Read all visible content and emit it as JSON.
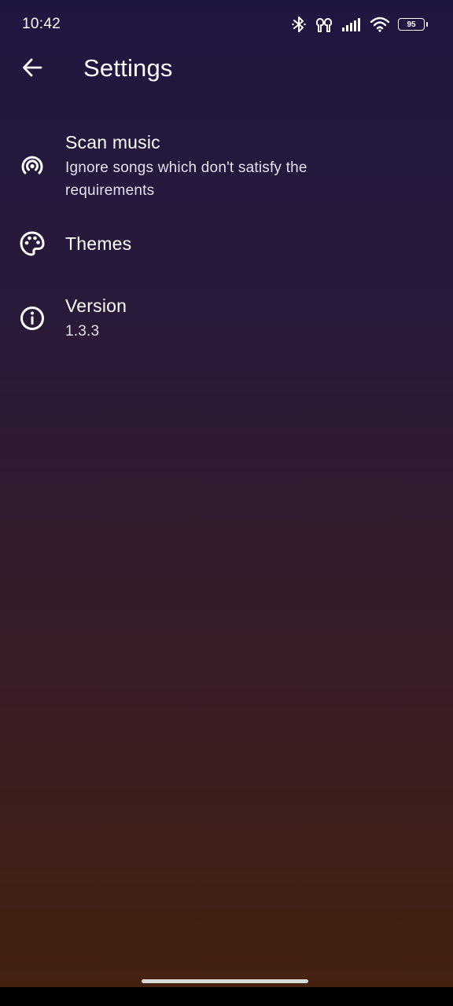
{
  "status_bar": {
    "time": "10:42",
    "icons": [
      "bluetooth-icon",
      "earbuds-icon",
      "signal-icon",
      "wifi-icon",
      "battery-icon"
    ],
    "battery_level": "95"
  },
  "app_bar": {
    "back_icon": "arrow-left-icon",
    "title": "Settings"
  },
  "settings": [
    {
      "icon": "scan-music-icon",
      "title": "Scan music",
      "subtitle": "Ignore songs which don't satisfy the requirements"
    },
    {
      "icon": "palette-icon",
      "title": "Themes"
    },
    {
      "icon": "info-icon",
      "title": "Version",
      "subtitle": "1.3.3"
    }
  ],
  "colors": {
    "gradient_top": "#1f1640",
    "gradient_bottom": "#44210f",
    "text": "#ffffff",
    "subtext": "#e6e0ee"
  }
}
